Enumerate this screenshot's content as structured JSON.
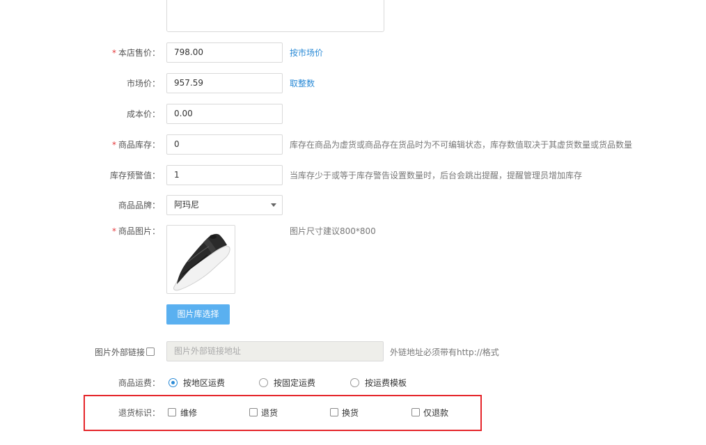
{
  "form": {
    "store_price": {
      "required": true,
      "label": "本店售价：",
      "value": "798.00",
      "action": "按市场价"
    },
    "market_price": {
      "required": false,
      "label": "市场价：",
      "value": "957.59",
      "action": "取整数"
    },
    "cost_price": {
      "required": false,
      "label": "成本价：",
      "value": "0.00"
    },
    "stock": {
      "required": true,
      "label": "商品库存：",
      "value": "0",
      "hint": "库存在商品为虚货或商品存在货品时为不可编辑状态，库存数值取决于其虚货数量或货品数量"
    },
    "stock_warning": {
      "required": false,
      "label": "库存预警值：",
      "value": "1",
      "hint": "当库存少于或等于库存警告设置数量时，后台会跳出提醒，提醒管理员增加库存"
    },
    "brand": {
      "required": false,
      "label": "商品品牌：",
      "selected": "阿玛尼"
    },
    "image": {
      "required": true,
      "label": "商品图片：",
      "hint": "图片尺寸建议800*800",
      "library_button": "图片库选择"
    },
    "external_link": {
      "label": "图片外部链接：",
      "placeholder": "图片外部链接地址",
      "hint": "外链地址必须带有http://格式"
    },
    "shipping": {
      "label": "商品运费：",
      "options": [
        {
          "label": "按地区运费",
          "checked": true
        },
        {
          "label": "按固定运费",
          "checked": false
        },
        {
          "label": "按运费模板",
          "checked": false
        }
      ]
    },
    "return_tags": {
      "label": "退货标识：",
      "options": [
        {
          "label": "维修",
          "checked": false
        },
        {
          "label": "退货",
          "checked": false
        },
        {
          "label": "换货",
          "checked": false
        },
        {
          "label": "仅退款",
          "checked": false
        }
      ]
    }
  },
  "colors": {
    "accent": "#2a8ad6",
    "required": "#e4393c",
    "primary_button": "#5ab0f0",
    "highlight": "#e5252a"
  },
  "icons": {
    "dropdown": "caret-down-icon",
    "product_image": "shoe-image"
  }
}
